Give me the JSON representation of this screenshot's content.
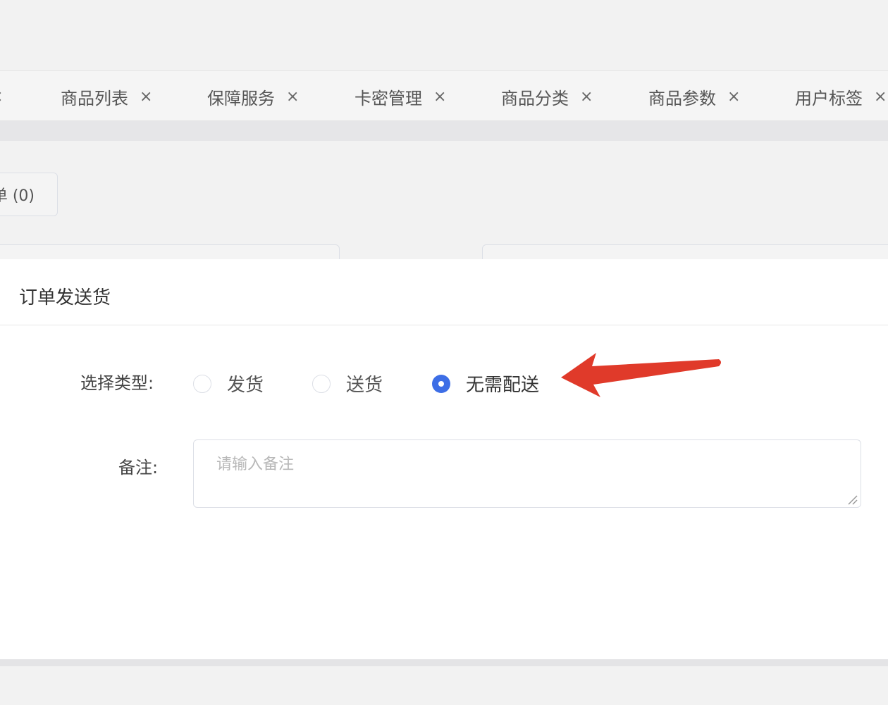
{
  "tabs": [
    {
      "label": "商品列表",
      "close": "×"
    },
    {
      "label": "保障服务",
      "close": "×"
    },
    {
      "label": "卡密管理",
      "close": "×"
    },
    {
      "label": "商品分类",
      "close": "×"
    },
    {
      "label": "商品参数",
      "close": "×"
    },
    {
      "label": "用户标签",
      "close": "×"
    }
  ],
  "tab_close_partial": "×",
  "background": {
    "button_label": "单 (0)"
  },
  "dialog": {
    "title": "订单发送货",
    "type_label": "选择类型:",
    "options": [
      {
        "label": "发货",
        "checked": false
      },
      {
        "label": "送货",
        "checked": false
      },
      {
        "label": "无需配送",
        "checked": true
      }
    ],
    "remark_label": "备注:",
    "remark_placeholder": "请输入备注",
    "remark_value": ""
  },
  "colors": {
    "accent": "#3d6ee6",
    "annotation_arrow": "#e03a2a"
  },
  "icons": {
    "tab_close": "close-icon",
    "annotation": "arrow-left-icon",
    "textarea_resize": "resize-grip-icon"
  }
}
